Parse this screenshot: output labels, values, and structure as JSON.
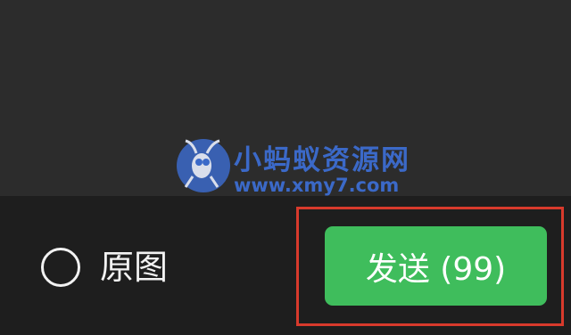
{
  "watermark": {
    "title": "小蚂蚁资源网",
    "url": "www.xmy7.com",
    "icon": "ant-logo-icon"
  },
  "bottom_bar": {
    "original_label": "原图",
    "original_checked": false,
    "send_label": "发送 (99)"
  },
  "colors": {
    "send_button": "#3fbd5c",
    "highlight_border": "#d83a2c",
    "watermark": "#3d6fd6",
    "bottom_bar": "#1e1e1e",
    "background": "#2b2b2b"
  },
  "icons": {
    "radio": "radio-unchecked-icon"
  }
}
